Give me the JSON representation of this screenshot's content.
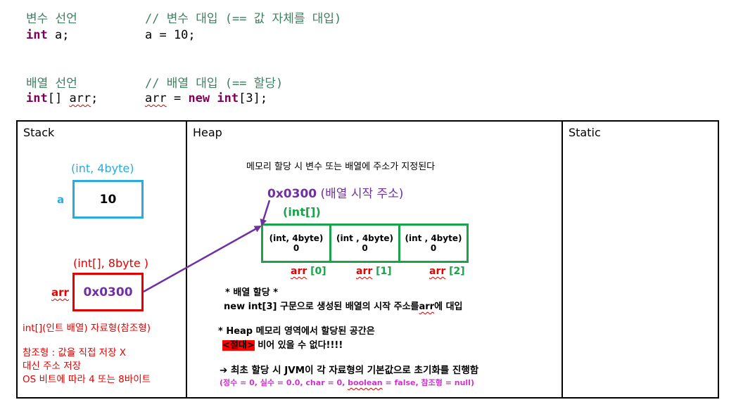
{
  "code": {
    "var_decl_comment": "변수 선언",
    "var_decl_type": "int",
    "var_decl_rest": " a;",
    "var_assign_comment": "// 변수 대입 (== 값 자체를 대입)",
    "var_assign_code": "a = 10;",
    "arr_decl_comment": "배열 선언",
    "arr_decl_type": "int",
    "arr_decl_brackets": "[] ",
    "arr_decl_name": "arr",
    "arr_decl_semi": ";",
    "arr_assign_comment": "// 배열 대입 (== 할당)",
    "arr_assign_name": "arr",
    "arr_assign_eq": " = ",
    "arr_assign_new": "new",
    "arr_assign_space": " ",
    "arr_assign_int": "int",
    "arr_assign_tail": "[3];"
  },
  "stack": {
    "title": "Stack",
    "a_type": "(int, 4byte)",
    "a_label": "a",
    "a_value": "10",
    "arr_type": "(int[], 8byte )",
    "arr_label": "arr",
    "arr_value": "0x0300",
    "note1": "int[](인트 배열) 자료형(참조형)",
    "note2": "참조형 : 값을 직접 저장 X",
    "note3": "대신 주소 저장",
    "note4": "OS 비트에 따라 4 또는 8바이트"
  },
  "heap": {
    "title": "Heap",
    "intro": "메모리 할당 시 변수 또는 배열에 주소가 지정된다",
    "addr": "0x0300",
    "addr_desc": " (배열 시작 주소)",
    "array_type": "(int[])",
    "cells": [
      {
        "type": "(int, 4byte)",
        "value": "0"
      },
      {
        "type": "(int , 4byte)",
        "value": "0"
      },
      {
        "type": "(int , 4byte)",
        "value": "0"
      }
    ],
    "index_labels": [
      {
        "name": "arr",
        "idx": " [0]"
      },
      {
        "name": "arr",
        "idx": " [1]"
      },
      {
        "name": "arr",
        "idx": " [2]"
      }
    ],
    "note_a1": "* 배열 할당 *",
    "note_a2a": "new int[3] 구문으로 생성된 배열의 시작 주소를",
    "note_a2b": "arr",
    "note_a2c": "에 대입",
    "note_b1": "* Heap 메모리 영역에서 할당된 공간은",
    "note_b2_hl": "<절대>",
    "note_b2_rest": " 비어 있을 수 없다!!!!",
    "note_c1": "➔ 최초 할당 시 JVM이 각 자료형의 기본값으로 초기화를 진행함",
    "note_c2a": "(정수 = 0, 실수 = 0.0, char = 0, ",
    "note_c2b": "boolean",
    "note_c2c": " = false,  참조형 = null)"
  },
  "static": {
    "title": "Static"
  },
  "colors": {
    "comment": "#3f7f5f",
    "keyword": "#7f0055",
    "stack_box": "#29abe2",
    "red": "#e60000",
    "purple": "#7030a0",
    "green": "#1aa34a",
    "highlight": "#ff0000",
    "magenta": "#cc33cc"
  }
}
